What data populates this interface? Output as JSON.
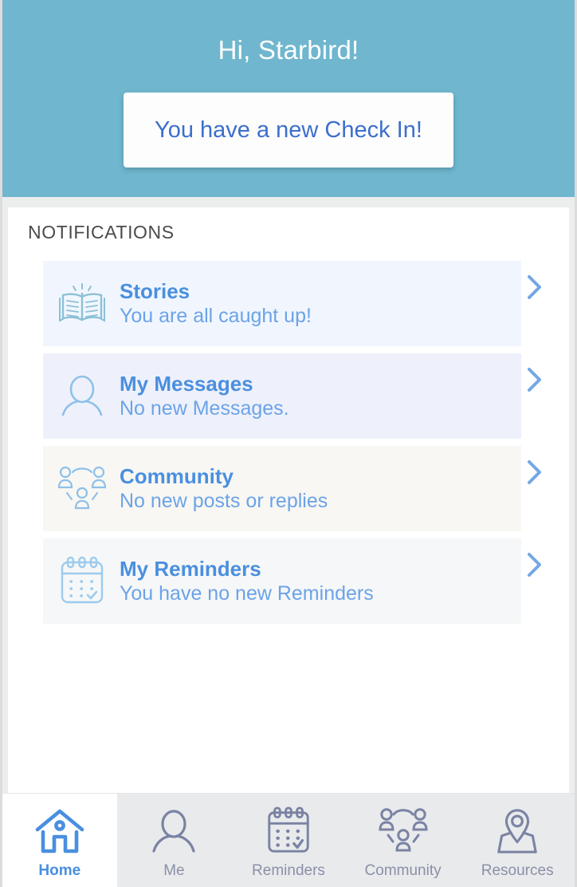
{
  "header": {
    "greeting": "Hi, Starbird!",
    "checkin_label": "You have a new Check In!",
    "bg_color": "#6fb6ce",
    "greeting_color": "#ffffff",
    "checkin_text_color": "#3c6fcc"
  },
  "notifications": {
    "section_title": "NOTIFICATIONS",
    "items": [
      {
        "icon": "open-book-icon",
        "title": "Stories",
        "subtitle": "You are all caught up!",
        "row_bg": "#f1f6fe",
        "icon_color": "#8cc0d4"
      },
      {
        "icon": "person-icon",
        "title": "My Messages",
        "subtitle": "No new Messages.",
        "row_bg": "#eef1fb",
        "icon_color": "#8dc0ea"
      },
      {
        "icon": "community-group-icon",
        "title": "Community",
        "subtitle": "No new posts or replies",
        "row_bg": "#f8f7f3",
        "icon_color": "#8dc0ea"
      },
      {
        "icon": "calendar-check-icon",
        "title": "My Reminders",
        "subtitle": "You have no new Reminders",
        "row_bg": "#f6f7f8",
        "icon_color": "#9ccbee"
      }
    ],
    "chevron_icon": "chevron-right-icon",
    "chevron_color": "#74a7e4",
    "title_color": "#4a8fe0",
    "subtitle_color": "#6ba3e8"
  },
  "bottom_nav": {
    "active_index": 0,
    "active_color": "#4a8fe0",
    "inactive_color": "#8b90a8",
    "tabs": [
      {
        "label": "Home",
        "icon": "home-icon",
        "active": true
      },
      {
        "label": "Me",
        "icon": "person-icon",
        "active": false
      },
      {
        "label": "Reminders",
        "icon": "calendar-check-icon",
        "active": false
      },
      {
        "label": "Community",
        "icon": "community-group-icon",
        "active": false
      },
      {
        "label": "Resources",
        "icon": "map-pin-icon",
        "active": false
      }
    ]
  }
}
